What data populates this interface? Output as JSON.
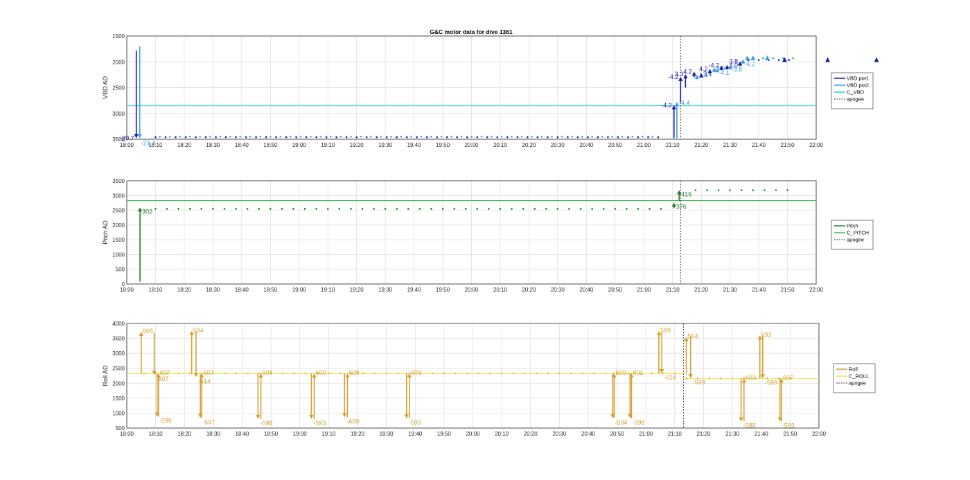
{
  "figure_title": "G&C motor data for dive 1361",
  "chart_data": [
    {
      "type": "line",
      "id": "vbd",
      "ylabel": "VBD AD",
      "y_reversed": true,
      "ylim": [
        1500,
        3500
      ],
      "yticks": [
        "1500",
        "2000",
        "2500",
        "3000",
        "3500"
      ],
      "xlim_minutes": [
        1080,
        1320
      ],
      "xticks": [
        "18:00",
        "18:10",
        "18:20",
        "18:30",
        "18:40",
        "18:50",
        "19:00",
        "19:10",
        "19:20",
        "19:30",
        "19:40",
        "19:50",
        "20:00",
        "20:10",
        "20:20",
        "20:30",
        "20:40",
        "20:50",
        "21:00",
        "21:10",
        "21:20",
        "21:30",
        "21:40",
        "21:50",
        "22:00"
      ],
      "grid": true,
      "legend": {
        "placement": "right",
        "entries": [
          "VBD pot1",
          "VBD pot2",
          "C_VBD",
          "apogee"
        ]
      },
      "colors": {
        "pot1": "#1a1aa6",
        "pot2": "#3d9ee8",
        "cvbd": "#27d3df",
        "apogee": "#333333"
      },
      "apogee_minutes": 1272.8,
      "c_level": 2850,
      "pot1_dots": {
        "start": 1090,
        "end": 1313,
        "step": 3.5,
        "early_value": 3460,
        "late_value": 1965
      },
      "pot2_dots": {
        "start": 1091.5,
        "end": 1313,
        "step": 3.5,
        "early_value": 3450,
        "late_value": 1930
      },
      "arrows": [
        {
          "series": "pot1",
          "t": 1083.3,
          "from": 1780,
          "to": 3480,
          "label": "-20.7",
          "label_side": "left"
        },
        {
          "series": "pot2",
          "t": 1084.5,
          "from": 1700,
          "to": 3480,
          "label": "-21.4",
          "label_side": "below"
        },
        {
          "series": "pot1",
          "t": 1270.5,
          "from": 3480,
          "to": 2840,
          "label": "-4.2",
          "label_side": "left"
        },
        {
          "series": "pot2",
          "t": 1271.5,
          "from": 3480,
          "to": 2780,
          "label": "-4.4",
          "label_side": "right"
        },
        {
          "series": "pot1",
          "t": 1272.8,
          "from": 2780,
          "to": 2290,
          "label": "-4.2",
          "label_side": "left"
        },
        {
          "series": "pot1",
          "t": 1274.5,
          "from": 2500,
          "to": 2240,
          "label": "3.3",
          "label_side": "left"
        },
        {
          "series": "pot1",
          "t": 1277.5,
          "from": 2300,
          "to": 2190,
          "label": "4.2",
          "label_side": "left"
        },
        {
          "series": "pot2",
          "t": 1278.5,
          "from": 2340,
          "to": 2250,
          "label": "1.4",
          "label_side": "right"
        },
        {
          "series": "pot1",
          "t": 1280,
          "from": 2300,
          "to": 2220,
          "label": "3.1",
          "label_side": "right"
        },
        {
          "series": "pot1",
          "t": 1283,
          "from": 2230,
          "to": 2140,
          "label": "4.2",
          "label_side": "left"
        },
        {
          "series": "pot2",
          "t": 1284.5,
          "from": 2200,
          "to": 2110,
          "label": "1.0",
          "label_side": "right"
        },
        {
          "series": "pot2",
          "t": 1285.5,
          "from": 2200,
          "to": 2120,
          "label": "-4.1",
          "label_side": "below"
        },
        {
          "series": "pot1",
          "t": 1287,
          "from": 2160,
          "to": 2070,
          "label": "-4.2",
          "label_side": "left"
        },
        {
          "series": "pot1",
          "t": 1289,
          "from": 2150,
          "to": 2060,
          "label": "4.0",
          "label_side": "right"
        },
        {
          "series": "pot2",
          "t": 1290,
          "from": 2150,
          "to": 2060,
          "label": "-3.8",
          "label_side": "below"
        },
        {
          "series": "pot1",
          "t": 1293.5,
          "from": 2080,
          "to": 1990,
          "label": "3.8",
          "label_side": "left"
        },
        {
          "series": "pot2",
          "t": 1294.5,
          "from": 2040,
          "to": 1950,
          "label": "-4.2",
          "label_side": "below"
        },
        {
          "series": "pot2",
          "t": 1296,
          "from": 1980,
          "to": 1880,
          "label": "",
          "label_side": "right"
        }
      ],
      "late_markers": [
        {
          "series": "pot1",
          "t": 1309
        },
        {
          "series": "pot1",
          "t": 1324
        },
        {
          "series": "pot1",
          "t": 1341
        },
        {
          "series": "pot2",
          "t": 1298
        },
        {
          "series": "pot2",
          "t": 1303
        }
      ]
    },
    {
      "type": "line",
      "id": "pitch",
      "ylabel": "Pitch AD",
      "y_reversed": false,
      "ylim": [
        0,
        3500
      ],
      "yticks": [
        "0",
        "500",
        "1000",
        "1500",
        "2000",
        "2500",
        "3000",
        "3500"
      ],
      "xlim_minutes": [
        1080,
        1320
      ],
      "xticks": [
        "18:00",
        "18:10",
        "18:20",
        "18:30",
        "18:40",
        "18:50",
        "19:00",
        "19:10",
        "19:20",
        "19:30",
        "19:40",
        "19:50",
        "20:00",
        "20:10",
        "20:20",
        "20:30",
        "20:40",
        "20:50",
        "21:00",
        "21:10",
        "21:20",
        "21:30",
        "21:40",
        "21:50",
        "22:00"
      ],
      "grid": true,
      "legend": {
        "placement": "right",
        "entries": [
          "Pitch",
          "C_PITCH",
          "apogee"
        ]
      },
      "colors": {
        "pitch": "#1e7d2a",
        "cpitch": "#3bc34a",
        "apogee": "#333333"
      },
      "apogee_minutes": 1272.8,
      "c_level": 2830,
      "dots": {
        "start": 1090,
        "end": 1313,
        "step": 4,
        "early_value": 2550,
        "late_value": 3180
      },
      "arrows": [
        {
          "t": 1084.6,
          "from": 80,
          "to": 2600,
          "label": "302",
          "label_side": "right_low"
        },
        {
          "t": 1270.5,
          "from": 2570,
          "to": 2760,
          "label": "376",
          "label_side": "right_low"
        },
        {
          "t": 1272.3,
          "from": 2820,
          "to": 3180,
          "label": "416",
          "label_side": "right_low"
        }
      ]
    },
    {
      "type": "line",
      "id": "roll",
      "ylabel": "Roll AD",
      "y_reversed": false,
      "ylim": [
        500,
        4000
      ],
      "yticks": [
        "500",
        "1000",
        "1500",
        "2000",
        "2500",
        "3000",
        "3500",
        "4000"
      ],
      "xlim_minutes": [
        1080,
        1320
      ],
      "xticks": [
        "18:00",
        "18:10",
        "18:20",
        "18:30",
        "18:40",
        "18:50",
        "19:00",
        "19:10",
        "19:20",
        "19:30",
        "19:40",
        "19:50",
        "20:00",
        "20:10",
        "20:20",
        "20:30",
        "20:40",
        "20:50",
        "21:00",
        "21:10",
        "21:20",
        "21:30",
        "21:40",
        "21:50",
        "22:00"
      ],
      "grid": true,
      "legend": {
        "placement": "right",
        "entries": [
          "Roll",
          "C_ROLL",
          "apogee"
        ]
      },
      "colors": {
        "roll": "#d3a130",
        "croll": "#f0e54a",
        "apogee": "#333333"
      },
      "apogee_minutes": 1273,
      "c_segments": [
        {
          "t0": 1080,
          "t1": 1273,
          "value": 2320
        },
        {
          "t0": 1273,
          "t1": 1320,
          "value": 2160
        }
      ],
      "dots": {
        "start": 1086,
        "end": 1313,
        "step": 4,
        "early_value": 2330,
        "late_value": 2160
      },
      "arrows": [
        {
          "t": 1085,
          "from": 2330,
          "to": 3720,
          "label": "605",
          "label_side": "right_top"
        },
        {
          "t": 1089.5,
          "from": 3700,
          "to": 2280,
          "label": "-607",
          "label_side": "right_low"
        },
        {
          "t": 1090.5,
          "from": 2310,
          "to": 880,
          "label": "-599",
          "label_side": "right_low"
        },
        {
          "t": 1091,
          "from": 880,
          "to": 2330,
          "label": "607",
          "label_side": "right_top"
        },
        {
          "t": 1102.5,
          "from": 2330,
          "to": 3750,
          "label": "594",
          "label_side": "right_top"
        },
        {
          "t": 1104,
          "from": 3750,
          "to": 2200,
          "label": "-614",
          "label_side": "right_low"
        },
        {
          "t": 1105.5,
          "from": 2300,
          "to": 840,
          "label": "-597",
          "label_side": "right_low"
        },
        {
          "t": 1106,
          "from": 840,
          "to": 2330,
          "label": "607",
          "label_side": "right_top"
        },
        {
          "t": 1125.5,
          "from": 2330,
          "to": 800,
          "label": "-598",
          "label_side": "right_low"
        },
        {
          "t": 1126.5,
          "from": 800,
          "to": 2330,
          "label": "604",
          "label_side": "right_top"
        },
        {
          "t": 1144,
          "from": 2330,
          "to": 800,
          "label": "-593",
          "label_side": "right_low"
        },
        {
          "t": 1145,
          "from": 800,
          "to": 2330,
          "label": "600",
          "label_side": "right_top"
        },
        {
          "t": 1155.5,
          "from": 2330,
          "to": 860,
          "label": "-600",
          "label_side": "right_low"
        },
        {
          "t": 1156.5,
          "from": 860,
          "to": 2330,
          "label": "609",
          "label_side": "right_top"
        },
        {
          "t": 1177,
          "from": 2330,
          "to": 820,
          "label": "-593",
          "label_side": "right_low"
        },
        {
          "t": 1178,
          "from": 820,
          "to": 2330,
          "label": "609",
          "label_side": "right_top"
        },
        {
          "t": 1248.5,
          "from": 2330,
          "to": 830,
          "label": "-594",
          "label_side": "right_low"
        },
        {
          "t": 1249,
          "from": 830,
          "to": 2330,
          "label": "599",
          "label_side": "right_top"
        },
        {
          "t": 1254.5,
          "from": 2330,
          "to": 830,
          "label": "-598",
          "label_side": "right_low"
        },
        {
          "t": 1255,
          "from": 830,
          "to": 2330,
          "label": "601",
          "label_side": "right_top"
        },
        {
          "t": 1264.5,
          "from": 2330,
          "to": 3750,
          "label": "589",
          "label_side": "right_top"
        },
        {
          "t": 1265.5,
          "from": 3720,
          "to": 2330,
          "label": "-614",
          "label_side": "right_low"
        },
        {
          "t": 1274,
          "from": 2300,
          "to": 3550,
          "label": "564",
          "label_side": "right_top"
        },
        {
          "t": 1275.5,
          "from": 3550,
          "to": 2170,
          "label": "-599",
          "label_side": "right_low"
        },
        {
          "t": 1293,
          "from": 2160,
          "to": 720,
          "label": "-588",
          "label_side": "right_low"
        },
        {
          "t": 1294,
          "from": 720,
          "to": 2160,
          "label": "603",
          "label_side": "right_top"
        },
        {
          "t": 1299.5,
          "from": 2160,
          "to": 3600,
          "label": "592",
          "label_side": "right_top"
        },
        {
          "t": 1300.5,
          "from": 3600,
          "to": 2160,
          "label": "-599",
          "label_side": "right_low"
        },
        {
          "t": 1306.5,
          "from": 2160,
          "to": 720,
          "label": "-593",
          "label_side": "right_low"
        },
        {
          "t": 1307,
          "from": 720,
          "to": 2160,
          "label": "607",
          "label_side": "right_top"
        }
      ]
    }
  ]
}
